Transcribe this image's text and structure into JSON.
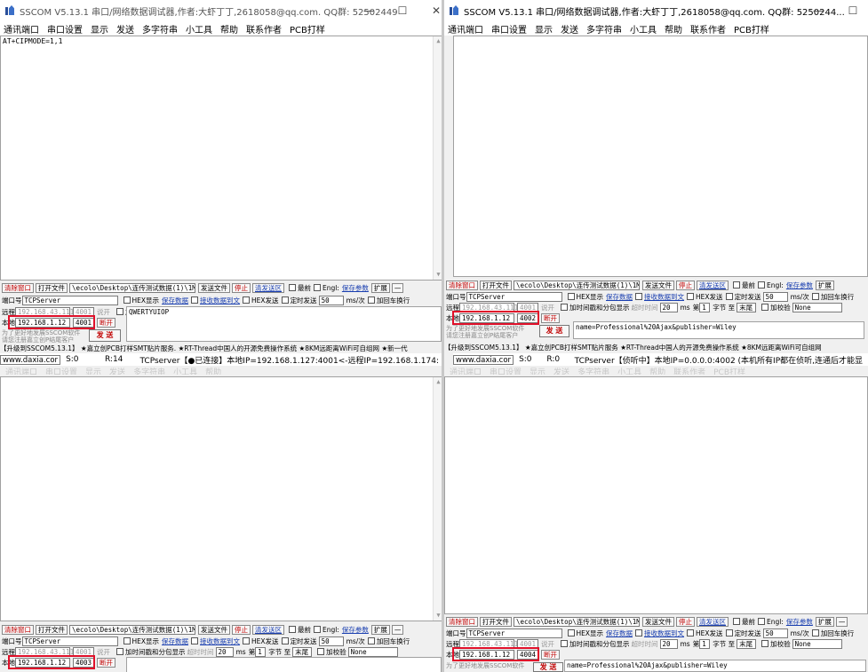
{
  "title_left": "SSCOM V5.13.1 串口/网络数据调试器,作者:大虾丁丁,2618058@qq.com. QQ群: 52502449",
  "title_right": "SSCOM V5.13.1 串口/网络数据调试器,作者:大虾丁丁,2618058@qq.com. QQ群: 5250244...",
  "win_controls": {
    "min": "—",
    "max": "☐",
    "close": "✕"
  },
  "menu": [
    "通讯端口",
    "串口设置",
    "显示",
    "发送",
    "多字符串",
    "小工具",
    "帮助",
    "联系作者",
    "PCB打样"
  ],
  "top_left": {
    "recv_text": "AT+CIPMODE=1,1",
    "send_text": "QWERTYUIOP",
    "port_value": "4001",
    "status": {
      "site": "www.daxia.cor",
      "s": "S:0",
      "r": "R:14",
      "conn": "TCPserver【●已连接】本地IP=192.168.1.127:4001<-远程IP=192.168.1.174:"
    }
  },
  "top_right": {
    "send_text": "name=Professional%20Ajax&publisher=Wiley",
    "port_value": "4002",
    "status": {
      "site": "www.daxia.cor",
      "s": "S:0",
      "r": "R:0",
      "conn": "TCPserver【侦听中】本地IP=0.0.0.0:4002 (本机所有IP都在侦听,连通后才能显"
    }
  },
  "bottom_left": {
    "port_value": "4003"
  },
  "bottom_right": {
    "send_text": "name=Professional%20Ajax&publisher=Wiley",
    "port_value": "4004"
  },
  "controls": {
    "clear_window": "清除窗口",
    "open_file": "打开文件",
    "file_path": "\\ecolo\\Desktop\\连传测试数据(1)\\1M.hex",
    "send_file": "发送文件",
    "stop": "停止",
    "clear_send": "清发送区",
    "front": "最前",
    "english": "Engl:",
    "save_params": "保存参数",
    "expand": "扩展",
    "collapse": "—",
    "port_label": "端口号",
    "port_type": "TCPServer",
    "hex_display": "HEX显示",
    "save_data": "保存数据",
    "recv_to_file": "接收数据到文",
    "hex_send": "HEX发送",
    "timed_send": "定时发送",
    "timed_value": "50",
    "timed_unit": "ms/次",
    "append_crlf": "加回车换行",
    "remote_label": "远程",
    "remote_ip": "192.168.43.111",
    "remote_port": "4001",
    "disconnect_gray": "说开",
    "timestamp": "加时间戳和分包显示",
    "timeout": "超时时间",
    "timeout_value": "20",
    "ms": "ms",
    "nth": "第",
    "byte_value": "1",
    "byte_unit": "字节 至",
    "end": "末尾",
    "checksum": "加校验",
    "checksum_value": "None",
    "local_label": "本地",
    "local_ip": "192.168.1.12",
    "disconnect": "断开",
    "send": "发 送",
    "promo1": "为了更好地发展SSCOM软件",
    "promo2": "请您注册嘉立创P结尾客户"
  },
  "ad_bar": "【升级到SSCOM5.13.1】 ★嘉立创PCB打样SMT贴片服务.  ★RT-Thread中国人的开源免费操作系统  ★8KM远距离WiFi可自组网  ★新一代",
  "ad_bar_right": "【升级到SSCOM5.13.1】 ★嘉立创PCB打样SMT贴片服务  ★RT-Thread中国人的开源免费操作系统  ★8KM远距离WiFi可自组网"
}
